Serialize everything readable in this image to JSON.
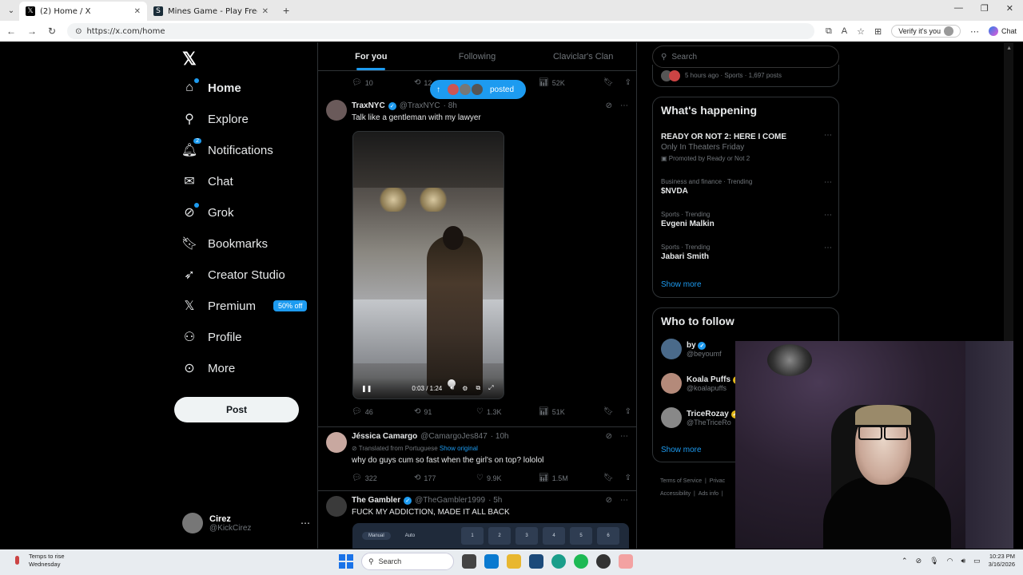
{
  "browser": {
    "tabs": [
      {
        "title": "(2) Home / X",
        "favicon": "x-logo"
      },
      {
        "title": "Mines Game - Play Free Social Cas",
        "favicon": "stake-logo"
      }
    ],
    "new_tab_icon": "+",
    "url": "https://x.com/home",
    "verify_label": "Verify it's you",
    "copilot_label": "Chat"
  },
  "nav": {
    "items": [
      {
        "label": "Home",
        "icon": "home-icon"
      },
      {
        "label": "Explore",
        "icon": "search-icon"
      },
      {
        "label": "Notifications",
        "icon": "bell-icon",
        "badge": "2"
      },
      {
        "label": "Chat",
        "icon": "mail-icon"
      },
      {
        "label": "Grok",
        "icon": "grok-icon"
      },
      {
        "label": "Bookmarks",
        "icon": "bookmark-icon"
      },
      {
        "label": "Creator Studio",
        "icon": "rocket-icon"
      },
      {
        "label": "Premium",
        "icon": "x-logo-icon",
        "promo": "50% off"
      },
      {
        "label": "Profile",
        "icon": "person-icon"
      },
      {
        "label": "More",
        "icon": "more-circle-icon"
      }
    ],
    "post_label": "Post",
    "account": {
      "name": "Cirez",
      "handle": "@KickCirez"
    }
  },
  "feed": {
    "tabs": [
      "For you",
      "Following",
      "Claviclar's Clan"
    ],
    "new_posts_label": "posted",
    "prev_actions": {
      "replies": "10",
      "reposts": "12",
      "views": "52K"
    },
    "posts": [
      {
        "name": "TraxNYC",
        "verified": true,
        "handle": "@TraxNYC",
        "time": "· 8h",
        "text": "Talk like a gentleman with my lawyer",
        "video_time": "0:03 / 1:24",
        "replies": "46",
        "reposts": "91",
        "likes": "1.3K",
        "views": "51K"
      },
      {
        "name": "Jéssica Camargo",
        "verified": false,
        "handle": "@CamargoJes847",
        "time": "· 10h",
        "translated": "Translated from Portuguese",
        "show_original": "Show original",
        "text": "why do guys cum so fast when the girl's on top? lololol",
        "replies": "322",
        "reposts": "177",
        "likes": "9.9K",
        "views": "1.5M"
      },
      {
        "name": "The Gambler",
        "verified": true,
        "handle": "@TheGambler1999",
        "time": "· 5h",
        "text": "FUCK MY ADDICTION, MADE IT ALL BACK",
        "game_tabs": [
          "Manual",
          "Auto"
        ],
        "game_cells": [
          "1",
          "2",
          "3",
          "4",
          "5",
          "6"
        ]
      }
    ]
  },
  "right": {
    "search_placeholder": "Search",
    "top_meta": "5 hours ago · Sports · 1,697 posts",
    "happening_title": "What's happening",
    "trends": [
      {
        "meta": "",
        "title": "READY OR NOT 2: HERE I COME",
        "sub": "Only In Theaters Friday",
        "promo": "Promoted by Ready or Not 2"
      },
      {
        "meta": "Business and finance · Trending",
        "title": "$NVDA"
      },
      {
        "meta": "Sports · Trending",
        "title": "Evgeni Malkin"
      },
      {
        "meta": "Sports · Trending",
        "title": "Jabari Smith"
      }
    ],
    "show_more": "Show more",
    "wtf_title": "Who to follow",
    "follow": [
      {
        "name": "by",
        "handle": "@beyoumf",
        "verified": true
      },
      {
        "name": "Koala Puffs",
        "handle": "@koalapuffs",
        "verified": true
      },
      {
        "name": "TriceRozay",
        "handle": "@TheTriceRo",
        "verified": true
      }
    ],
    "footer": [
      "Terms of Service",
      "|",
      "Privac",
      "Accessibility",
      "|",
      "Ads info",
      "|"
    ]
  },
  "taskbar": {
    "weather_line1": "Temps to rise",
    "weather_line2": "Wednesday",
    "search_label": "Search",
    "time": "10:23 PM",
    "date": "3/16/2026"
  }
}
